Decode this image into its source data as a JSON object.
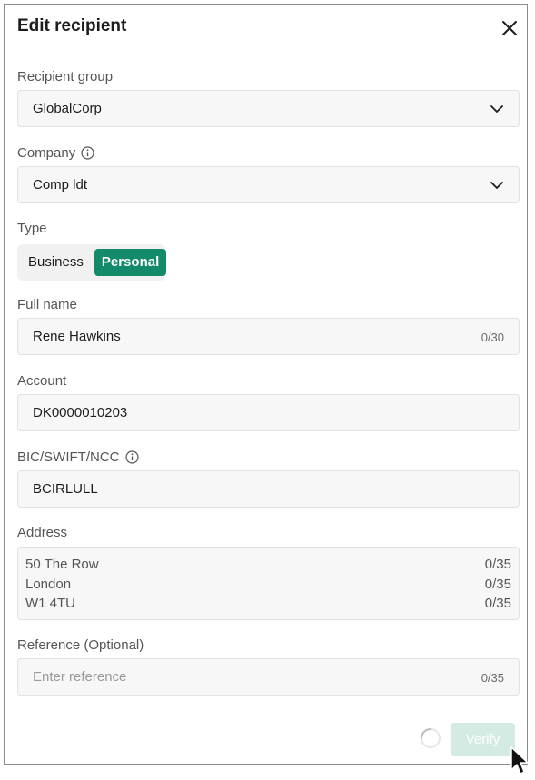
{
  "dialog": {
    "title": "Edit recipient"
  },
  "recipient_group": {
    "label": "Recipient group",
    "value": "GlobalCorp"
  },
  "company": {
    "label": "Company",
    "value": "Comp ldt"
  },
  "type": {
    "label": "Type",
    "options": [
      "Business",
      "Personal"
    ],
    "selected": "Personal"
  },
  "full_name": {
    "label": "Full name",
    "value": "Rene Hawkins",
    "counter": "0/30"
  },
  "account": {
    "label": "Account",
    "value": "DK0000010203"
  },
  "bic": {
    "label": "BIC/SWIFT/NCC",
    "value": "BCIRLULL"
  },
  "address": {
    "label": "Address",
    "lines": [
      {
        "value": "50 The Row",
        "counter": "0/35"
      },
      {
        "value": "London",
        "counter": "0/35"
      },
      {
        "value": "W1 4TU",
        "counter": "0/35"
      }
    ]
  },
  "reference": {
    "label": "Reference (Optional)",
    "placeholder": "Enter reference",
    "counter": "0/35"
  },
  "actions": {
    "verify_label": "Verify"
  },
  "colors": {
    "accent": "#138a69",
    "verify_disabled": "#d3ebe3"
  }
}
